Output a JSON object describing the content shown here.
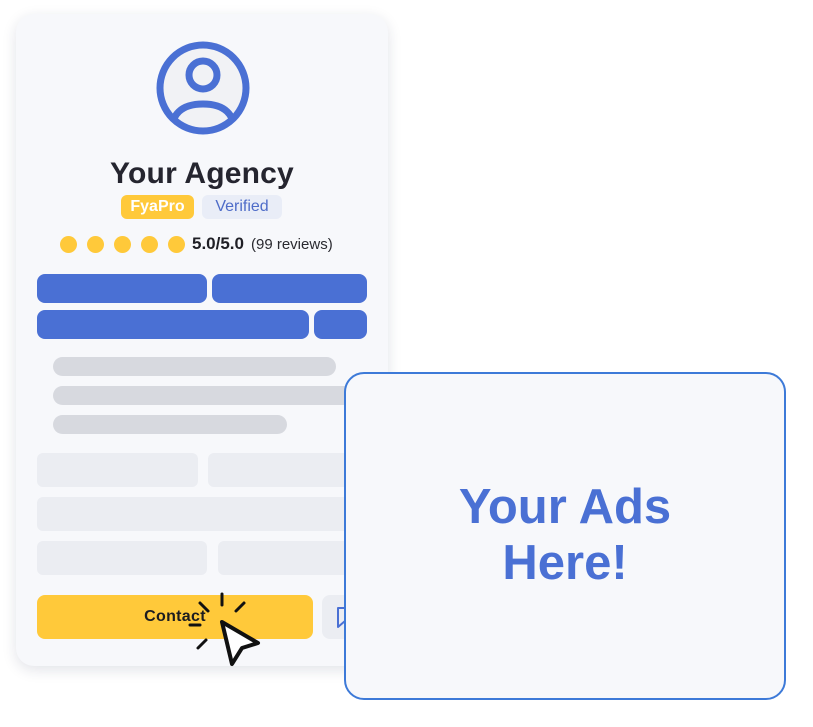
{
  "card": {
    "agency_name": "Your Agency",
    "badges": [
      "FyaPro",
      "Verified"
    ],
    "rating": {
      "stars": 5,
      "score": "5.0/5.0",
      "reviews": "(99 reviews)"
    },
    "contact_label": "Contact"
  },
  "ad": {
    "line1": "Your Ads",
    "line2": "Here!"
  },
  "colors": {
    "brand_blue": "#4a70d4",
    "accent_yellow": "#ffc93a",
    "ad_border": "#3d7ad8"
  },
  "icons": [
    "user-avatar-icon",
    "save-icon",
    "pointer-cursor-icon"
  ]
}
